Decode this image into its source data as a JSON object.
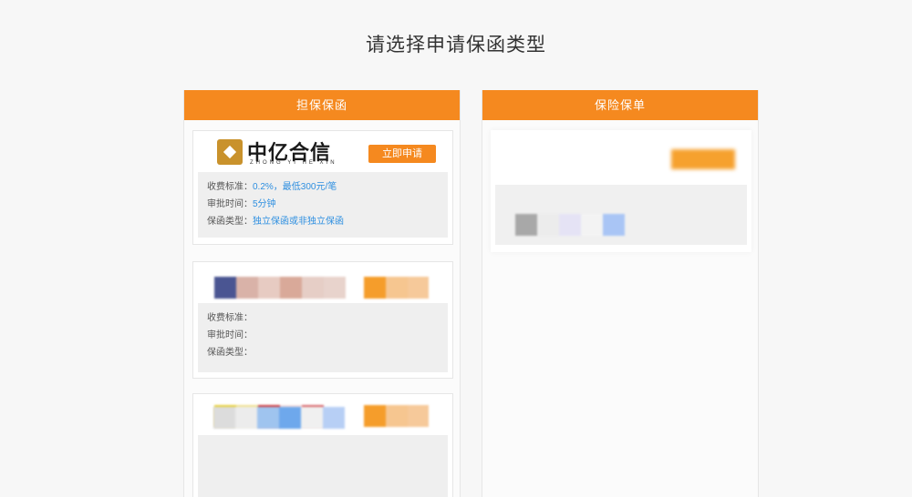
{
  "page": {
    "title": "请选择申请保函类型"
  },
  "columns": [
    {
      "header": "担保保函"
    },
    {
      "header": "保险保单"
    }
  ],
  "guarantee_cards": [
    {
      "logo_name": "中亿合信",
      "logo_sub": "ZHONG YI HE XIN",
      "apply_label": "立即申请",
      "rows": [
        {
          "label": "收费标准：",
          "value": "0.2%，最低300元/笔"
        },
        {
          "label": "审批时间：",
          "value": "5分钟"
        },
        {
          "label": "保函类型：",
          "value": "独立保函或非独立保函"
        }
      ]
    },
    {
      "rows": [
        {
          "label": "收费标准：",
          "value": ""
        },
        {
          "label": "审批时间：",
          "value": ""
        },
        {
          "label": "保函类型：",
          "value": ""
        }
      ]
    }
  ],
  "colors": {
    "accent": "#f5891f",
    "link": "#2e8fe0",
    "background": "#f7f7f7"
  }
}
